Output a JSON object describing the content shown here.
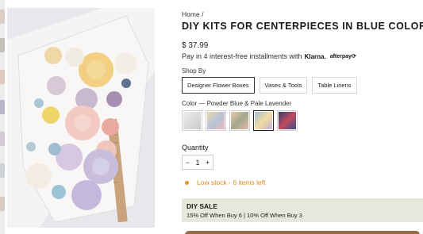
{
  "breadcrumb": {
    "home": "Home",
    "separator": "/"
  },
  "product": {
    "title": "DIY KITS FOR CENTERPIECES IN BLUE COLORS",
    "price": "$ 37.99",
    "installments_text": "Pay in 4 interest-free installments with",
    "klarna": "Klarna.",
    "afterpay": "afterpay⟳"
  },
  "options": {
    "shop_by_label": "Shop By",
    "shop_by": [
      "Designer Flower Boxes",
      "Vases & Tools",
      "Table Linens"
    ],
    "shop_by_selected": 0,
    "color_label": "Color — Powder Blue & Pale Lavender",
    "swatches": [
      {
        "name": "swatch-white-gray",
        "color": "#d7d8da"
      },
      {
        "name": "swatch-pastel-mix",
        "color": "#c9b7a6"
      },
      {
        "name": "swatch-peach-mix",
        "color": "#d4a991"
      },
      {
        "name": "swatch-powder-blue-lavender",
        "color": "#aeb9d6"
      },
      {
        "name": "swatch-navy-red",
        "color": "#3b3f6b"
      }
    ],
    "swatch_selected": 3
  },
  "quantity": {
    "label": "Quantity",
    "value": "1",
    "minus": "−",
    "plus": "+"
  },
  "stock": {
    "text": "Low stock - 6 items left",
    "color": "#d88a1e"
  },
  "sale": {
    "title": "DIY SALE",
    "text": "15% Off When Buy 6 | 10% Off When Buy 3"
  }
}
